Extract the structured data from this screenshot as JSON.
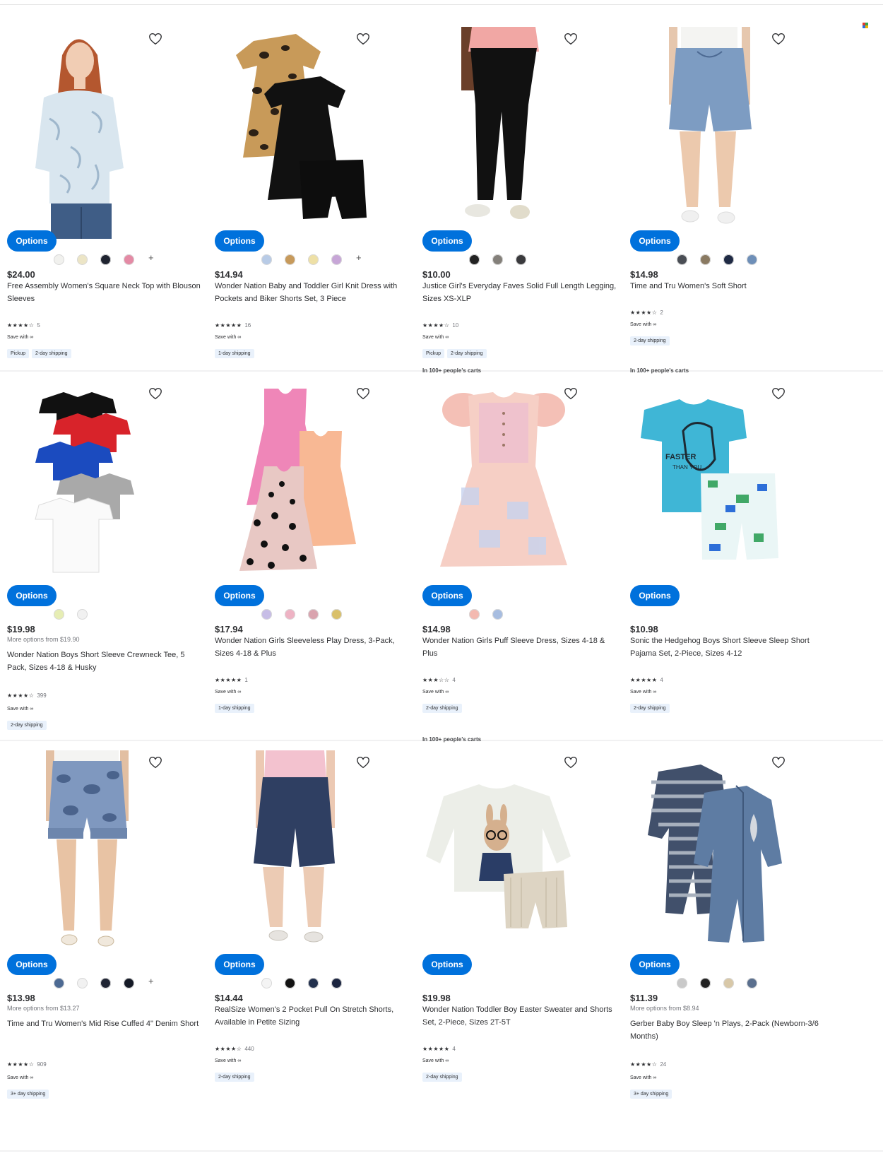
{
  "products": [
    {
      "badge": "",
      "price": "$24.00",
      "more_options": "",
      "title": "Free Assembly Women's Square Neck Top with Blouson Sleeves",
      "stars": "★★★★☆",
      "reviews": "5",
      "save": "Save with ∞",
      "shipping": [
        "Pickup",
        "2-day shipping"
      ],
      "swatches": [
        "#f1f1ee",
        "#ece5c6",
        "#1f2330",
        "#e48aa5"
      ],
      "has_more_swatches": true,
      "option_label": "Options",
      "image": "blouse"
    },
    {
      "badge": "",
      "price": "$14.94",
      "more_options": "",
      "title": "Wonder Nation Baby and Toddler Girl Knit Dress with Pockets and Biker Shorts Set, 3 Piece",
      "stars": "★★★★★",
      "reviews": "16",
      "save": "Save with ∞",
      "shipping": [
        "1-day shipping"
      ],
      "swatches": [
        "#b8cbe6",
        "#c79a5b",
        "#eee0a6",
        "#c7a6d7"
      ],
      "has_more_swatches": true,
      "option_label": "Options",
      "image": "dress-set"
    },
    {
      "badge": "",
      "price": "$10.00",
      "more_options": "",
      "title": "Justice Girl's Everyday Faves Solid Full Length Legging, Sizes XS-XLP",
      "stars": "★★★★☆",
      "reviews": "10",
      "save": "Save with ∞",
      "shipping": [
        "Pickup",
        "2-day shipping"
      ],
      "swatches": [
        "#222222",
        "#84807a",
        "#3a3a3d"
      ],
      "has_more_swatches": false,
      "option_label": "Options",
      "image": "legging"
    },
    {
      "badge": "",
      "price": "$14.98",
      "more_options": "",
      "title": "Time and Tru Women's Soft Short",
      "stars": "★★★★☆",
      "reviews": "2",
      "save": "Save with ∞",
      "shipping": [
        "2-day shipping"
      ],
      "swatches": [
        "#4a4e55",
        "#8a7a62",
        "#1f2a44",
        "#6e8fb8"
      ],
      "has_more_swatches": false,
      "option_label": "Options",
      "image": "soft-short"
    },
    {
      "badge": "",
      "price": "$19.98",
      "more_options": "More options from $19.90",
      "title": "Wonder Nation Boys Short Sleeve Crewneck Tee, 5 Pack, Sizes 4-18 & Husky",
      "stars": "★★★★☆",
      "reviews": "399",
      "save": "Save with ∞",
      "shipping": [
        "2-day shipping"
      ],
      "swatches": [
        "#e6edb4",
        "#f1f1f1"
      ],
      "has_more_swatches": false,
      "option_label": "Options",
      "image": "tees"
    },
    {
      "badge": "",
      "price": "$17.94",
      "more_options": "",
      "title": "Wonder Nation Girls Sleeveless Play Dress, 3-Pack, Sizes 4-18 & Plus",
      "stars": "★★★★★",
      "reviews": "1",
      "save": "Save with ∞",
      "shipping": [
        "1-day shipping"
      ],
      "swatches": [
        "#c7bde6",
        "#eeb3c4",
        "#d9a3ae",
        "#d9c06a"
      ],
      "has_more_swatches": false,
      "option_label": "Options",
      "image": "play-dress"
    },
    {
      "badge": "In 100+ people's carts",
      "price": "$14.98",
      "more_options": "",
      "title": "Wonder Nation Girls Puff Sleeve Dress, Sizes 4-18 & Plus",
      "stars": "★★★☆☆",
      "reviews": "4",
      "save": "Save with ∞",
      "shipping": [
        "2-day shipping"
      ],
      "swatches": [
        "#f3b9b0",
        "#a7bde0"
      ],
      "has_more_swatches": false,
      "option_label": "Options",
      "image": "puff-dress"
    },
    {
      "badge": "In 100+ people's carts",
      "price": "$10.98",
      "more_options": "",
      "title": "Sonic the Hedgehog Boys Short Sleeve Sleep Short Pajama Set, 2-Piece, Sizes 4-12",
      "stars": "★★★★★",
      "reviews": "4",
      "save": "Save with ∞",
      "shipping": [
        "2-day shipping"
      ],
      "swatches": [],
      "has_more_swatches": false,
      "option_label": "Options",
      "image": "sonic"
    },
    {
      "badge": "",
      "price": "$13.98",
      "more_options": "More options from $13.27",
      "title": "Time and Tru Women's Mid Rise Cuffed 4\" Denim Short",
      "stars": "★★★★☆",
      "reviews": "909",
      "save": "Save with ∞",
      "shipping": [
        "3+ day shipping"
      ],
      "swatches": [
        "#4d6a93",
        "#f1f1f1",
        "#1f2433",
        "#151a26"
      ],
      "has_more_swatches": true,
      "option_label": "Options",
      "image": "denim-short"
    },
    {
      "badge": "",
      "price": "$14.44",
      "more_options": "",
      "title": "RealSize Women's 2 Pocket Pull On Stretch Shorts, Available in Petite Sizing",
      "stars": "★★★★☆",
      "reviews": "440",
      "save": "Save with ∞",
      "shipping": [
        "2-day shipping"
      ],
      "swatches": [
        "#f4f4f4",
        "#131313",
        "#22304d",
        "#1b2540"
      ],
      "has_more_swatches": false,
      "option_label": "Options",
      "image": "navy-short"
    },
    {
      "badge": "In 100+ people's carts",
      "price": "$19.98",
      "more_options": "",
      "title": "Wonder Nation Toddler Boy Easter Sweater and Shorts Set, 2-Piece, Sizes 2T-5T",
      "stars": "★★★★★",
      "reviews": "4",
      "save": "Save with ∞",
      "shipping": [
        "2-day shipping"
      ],
      "swatches": [],
      "has_more_swatches": false,
      "option_label": "Options",
      "image": "sweater-set"
    },
    {
      "badge": "",
      "price": "$11.39",
      "more_options": "More options from $8.94",
      "title": "Gerber Baby Boy Sleep 'n Plays, 2-Pack (Newborn-3/6 Months)",
      "stars": "★★★★☆",
      "reviews": "24",
      "save": "Save with ∞",
      "shipping": [
        "3+ day shipping"
      ],
      "swatches": [
        "#c9c9c9",
        "#222222",
        "#d8c8a8",
        "#5a6f8e"
      ],
      "has_more_swatches": false,
      "option_label": "Options",
      "image": "sleep-play"
    }
  ]
}
